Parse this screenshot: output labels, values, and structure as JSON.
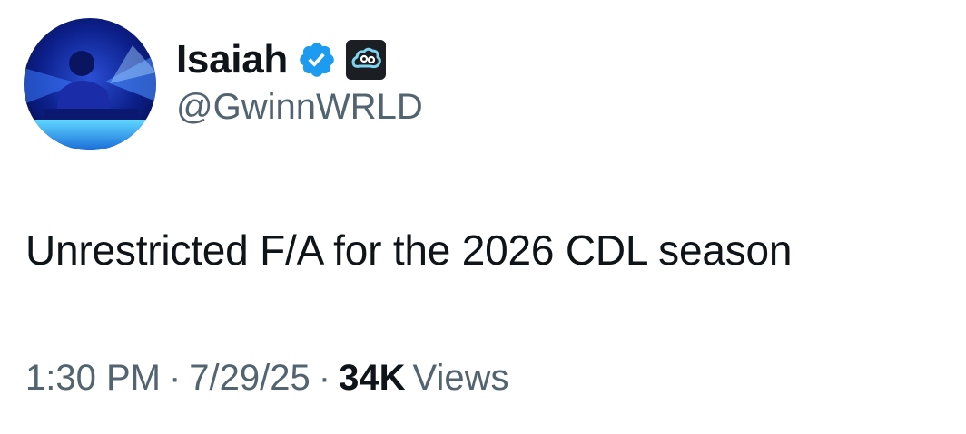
{
  "author": {
    "display_name": "Isaiah",
    "handle": "@GwinnWRLD",
    "verified": true,
    "affiliate_badge": "cloud9-logo-icon"
  },
  "tweet": {
    "text": "Unrestricted F/A for the 2026 CDL season",
    "time": "1:30 PM",
    "separator": "·",
    "date": "7/29/25",
    "views_count": "34K",
    "views_label": "Views"
  },
  "colors": {
    "text_primary": "#0f1419",
    "text_secondary": "#536471",
    "verified_blue": "#1d9bf0",
    "badge_bg": "#1b1f23",
    "badge_accent": "#7fd3ef"
  }
}
